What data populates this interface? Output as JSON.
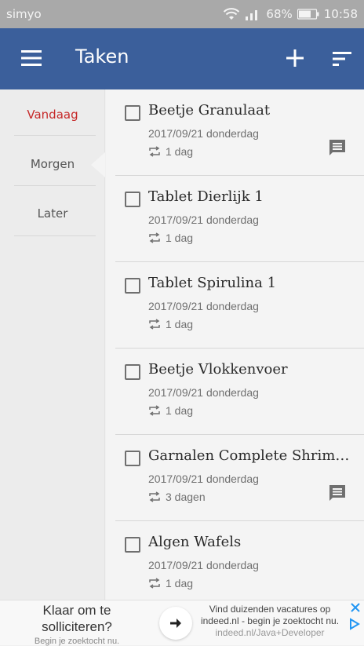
{
  "status_bar": {
    "carrier": "simyo",
    "battery": "68%",
    "time": "10:58"
  },
  "app_bar": {
    "title": "Taken",
    "icons": [
      "menu-icon",
      "add-icon",
      "sort-icon"
    ]
  },
  "sidebar": {
    "items": [
      {
        "label": "Vandaag",
        "active": true
      },
      {
        "label": "Morgen",
        "active": false
      },
      {
        "label": "Later",
        "active": false
      }
    ]
  },
  "tasks": [
    {
      "title": "Beetje Granulaat",
      "date": "2017/09/21 donderdag",
      "repeat": "1 dag",
      "has_comment": true
    },
    {
      "title": "Tablet Dierlijk 1",
      "date": "2017/09/21 donderdag",
      "repeat": "1 dag",
      "has_comment": false
    },
    {
      "title": "Tablet Spirulina 1",
      "date": "2017/09/21 donderdag",
      "repeat": "1 dag",
      "has_comment": false
    },
    {
      "title": "Beetje Vlokkenvoer",
      "date": "2017/09/21 donderdag",
      "repeat": "1 dag",
      "has_comment": false
    },
    {
      "title": "Garnalen Complete Shrim…",
      "date": "2017/09/21 donderdag",
      "repeat": "3 dagen",
      "has_comment": true
    },
    {
      "title": "Algen Wafels",
      "date": "2017/09/21 donderdag",
      "repeat": "1 dag",
      "has_comment": false
    }
  ],
  "ad": {
    "headline_line1": "Klaar om te",
    "headline_line2": "solliciteren?",
    "subtext": "Begin je zoektocht nu.",
    "body_line1": "Vind duizenden vacatures op",
    "body_line2": "indeed.nl - begin je zoektocht nu.",
    "url": "indeed.nl/Java+Developer"
  },
  "colors": {
    "app_bar": "#3b5f9b",
    "active_tab": "#c62828",
    "status_bar": "#a9a9a9"
  }
}
